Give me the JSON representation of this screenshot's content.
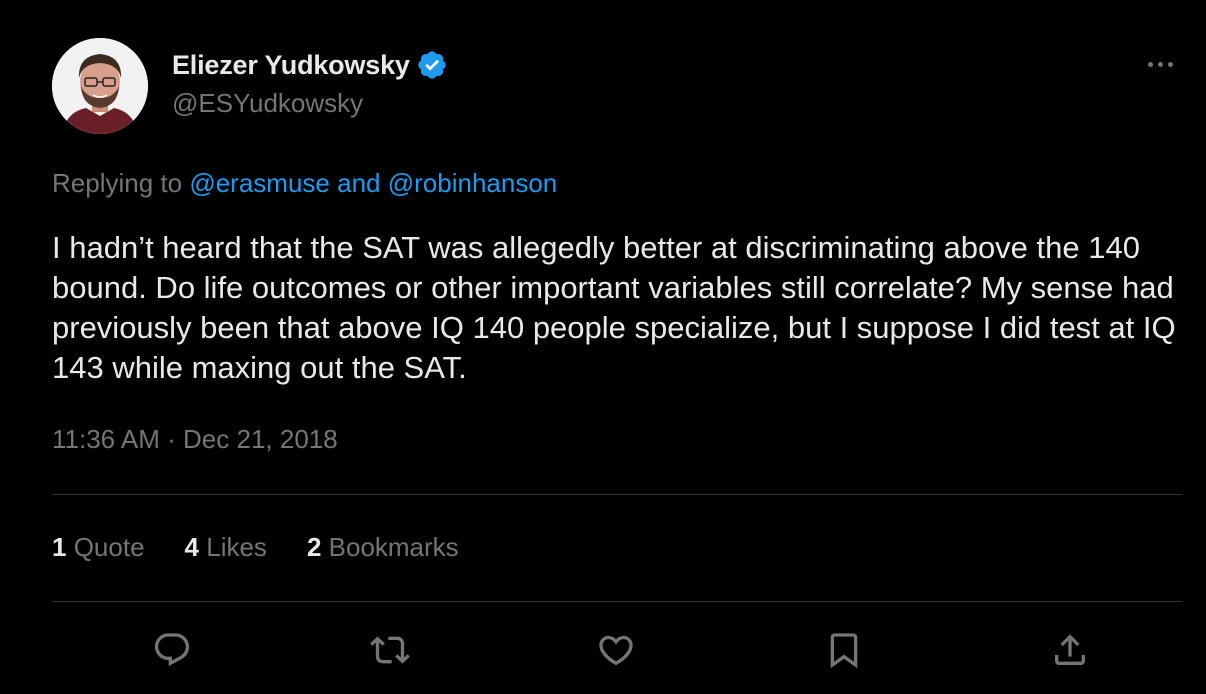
{
  "author": {
    "display_name": "Eliezer Yudkowsky",
    "handle": "@ESYudkowsky",
    "verified": true,
    "avatar_icon": "profile-photo"
  },
  "reply_context": {
    "prefix": "Replying to",
    "mention_1": "@erasmuse",
    "conjunction": "and",
    "mention_2": "@robinhanson"
  },
  "tweet": {
    "text": "I hadn’t heard that the SAT was allegedly better at discriminating above the 140 bound.  Do life outcomes or other important variables still correlate?  My sense had previously been that above IQ 140 people specialize, but I suppose I did test at IQ 143 while maxing out the SAT.",
    "timestamp": "11:36 AM · Dec 21, 2018"
  },
  "stats": {
    "quotes_count": "1",
    "quotes_label": "Quote",
    "likes_count": "4",
    "likes_label": "Likes",
    "bookmarks_count": "2",
    "bookmarks_label": "Bookmarks"
  },
  "actions": {
    "reply_icon": "reply-icon",
    "retweet_icon": "retweet-icon",
    "like_icon": "heart-icon",
    "bookmark_icon": "bookmark-icon",
    "share_icon": "share-icon"
  },
  "colors": {
    "background": "#000000",
    "text_primary": "#e7e9ea",
    "text_secondary": "#71767b",
    "link": "#1d9bf0",
    "divider": "#2f3336",
    "verified": "#1d9bf0"
  }
}
